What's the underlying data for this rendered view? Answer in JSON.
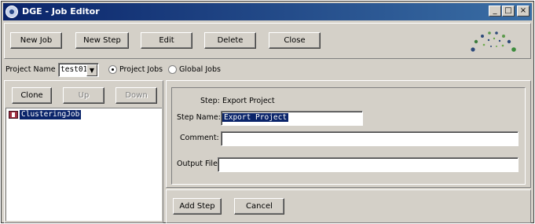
{
  "window": {
    "title": "DGE - Job Editor",
    "controls": {
      "minimize": "_",
      "maximize": "□",
      "close": "×"
    }
  },
  "toolbar": {
    "new_job": "New Job",
    "new_step": "New Step",
    "edit": "Edit",
    "delete": "Delete",
    "close": "Close"
  },
  "logo": {
    "name": "dge-logo",
    "colors": [
      "#2e4a7a",
      "#3c8c3c",
      "#6aaa4a",
      "#1a3060"
    ]
  },
  "project": {
    "label": "Project Name",
    "selected": "test01",
    "scope_options": [
      {
        "label": "Project Jobs",
        "selected": true
      },
      {
        "label": "Global Jobs",
        "selected": false
      }
    ]
  },
  "list_controls": {
    "clone": "Clone",
    "up": "Up",
    "down": "Down"
  },
  "tree": {
    "items": [
      {
        "label": "ClusteringJob",
        "selected": true
      }
    ]
  },
  "step_form": {
    "step_label": "Step:",
    "step_value": "Export Project",
    "step_name_label": "Step Name:",
    "step_name_value": "Export Project",
    "comment_label": "Comment:",
    "comment_value": "",
    "output_file_label": "Output File:",
    "output_file_value": ""
  },
  "actions": {
    "add_step": "Add Step",
    "cancel": "Cancel"
  }
}
